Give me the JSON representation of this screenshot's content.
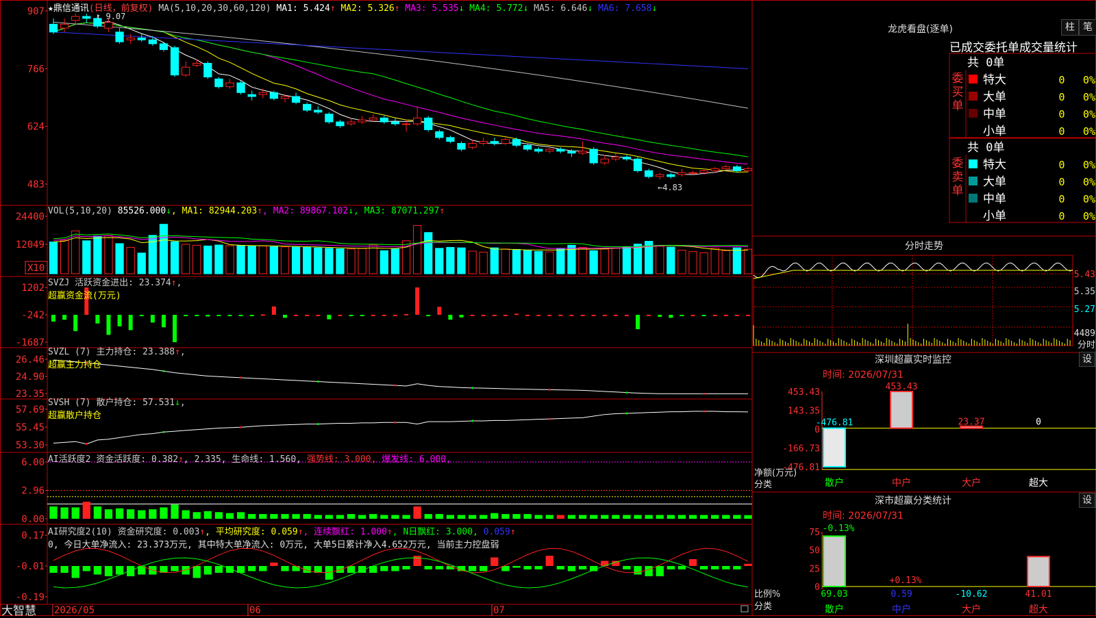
{
  "colors": {
    "up": "#ff2020",
    "down": "#00ffff",
    "ma1": "#ffffff",
    "ma2": "#ffff00",
    "ma3": "#ff00ff",
    "ma4": "#00ff00",
    "ma5": "#c0c0c0",
    "ma6": "#3333ff",
    "frame": "#c00000",
    "green": "#00ff00"
  },
  "header": {
    "star": "★",
    "name": "鼎信通讯",
    "mode": "(日线，前复权)",
    "ma_label": "MA(5,10,20,30,60,120)",
    "ma": [
      {
        "label": "MA1:",
        "value": "5.424",
        "arrow": "↑"
      },
      {
        "label": "MA2:",
        "value": "5.326",
        "arrow": "↑"
      },
      {
        "label": "MA3:",
        "value": "5.535",
        "arrow": "↓"
      },
      {
        "label": "MA4:",
        "value": "5.772",
        "arrow": "↓"
      },
      {
        "label": "MA5:",
        "value": "6.646",
        "arrow": "↓"
      },
      {
        "label": "MA6:",
        "value": "7.658",
        "arrow": "↓"
      }
    ],
    "high_mark": "9.07",
    "low_mark": "4.83"
  },
  "axes": {
    "price": [
      "907",
      "766",
      "624",
      "483"
    ],
    "vol": [
      "24400",
      "12049"
    ],
    "vol_unit": "X10",
    "svzj": [
      "1202",
      "-242",
      "-1687"
    ],
    "svzl": [
      "26.46",
      "24.90",
      "23.35"
    ],
    "svsh": [
      "57.69",
      "55.45",
      "53.30"
    ],
    "ai": [
      "6.00",
      "2.96",
      "0.00"
    ],
    "ai2": [
      "0.17",
      "-0.01",
      "-0.19"
    ]
  },
  "vol_header": {
    "label": "VOL(5,10,20)",
    "value": "85526.000",
    "arrow": "↓",
    "ma": [
      {
        "label": "MA1:",
        "value": "82944.203",
        "arrow": "↑"
      },
      {
        "label": "MA2:",
        "value": "89867.102",
        "arrow": "↓"
      },
      {
        "label": "MA3:",
        "value": "87071.297",
        "arrow": "↑"
      }
    ]
  },
  "svzj_header": {
    "label": "SVZJ  活跃资金进出: 23.374",
    "arrow": "↑",
    "sub": "超赢资金流(万元)"
  },
  "svzl_header": {
    "label": "SVZL (7) 主力持仓: 23.388",
    "arrow": "↑",
    "sub": "超赢主力持仓"
  },
  "svsh_header": {
    "label": "SVSH (7) 散户持仓: 57.531",
    "arrow": "↓",
    "sub": "超赢散户持仓"
  },
  "ai_header": {
    "a": "AI活跃度2 资金活跃度: 0.382",
    "a_arrow": "↑",
    "b": ", 2.335, 生命线: 1.560,",
    "c": "强势线: 3.000,",
    "d": "爆发线: 6.000,"
  },
  "ai2_header": {
    "a": "AI研究度2(10) 资金研究度: 0.003",
    "a_arrow": "↑",
    "b": ", 平均研究度: 0.059",
    "b_arrow": "↑",
    "c": ", 连续飘红: 1.000",
    "c_arrow": "↑",
    "d": ", N日飘红: 3.000,",
    "e": "0.059",
    "e_arrow": "↑"
  },
  "ai2_note": "0, 今日大单净流入: 23.373万元, 其中特大单净流入: 0万元, 大单5日累计净入4.652万元, 当前主力控盘弱",
  "bottom": {
    "brand": "大智慧",
    "dates": [
      "2026/05",
      "06",
      "07"
    ]
  },
  "dragon": {
    "title": "龙虎看盘(逐单)",
    "btn_a": "柱",
    "btn_b": "笔",
    "subtitle": "已成交委托单成交量统计",
    "buy": {
      "side": "委买单",
      "total": "共 0单",
      "rows": [
        {
          "name": "特大",
          "value": "0",
          "pct": "0%",
          "color": "#ff0000"
        },
        {
          "name": "大单",
          "value": "0",
          "pct": "0%",
          "color": "#990000"
        },
        {
          "name": "中单",
          "value": "0",
          "pct": "0%",
          "color": "#660000"
        },
        {
          "name": "小单",
          "value": "0",
          "pct": "0%",
          "color": "#000000"
        }
      ]
    },
    "sell": {
      "side": "委卖单",
      "total": "共 0单",
      "rows": [
        {
          "name": "特大",
          "value": "0",
          "pct": "0%",
          "color": "#00ffff"
        },
        {
          "name": "大单",
          "value": "0",
          "pct": "0%",
          "color": "#009999"
        },
        {
          "name": "中单",
          "value": "0",
          "pct": "0%",
          "color": "#007777"
        },
        {
          "name": "小单",
          "value": "0",
          "pct": "0%",
          "color": "#000000"
        }
      ]
    }
  },
  "intraday": {
    "title": "分时走势",
    "prices": [
      "5.43",
      "5.35",
      "5.27"
    ],
    "vol": "4489",
    "vol_label": "分时"
  },
  "monitor": {
    "title": "深圳超赢实时监控",
    "btn": "设",
    "time": "时间: 2026/07/31",
    "axis": [
      "453.43",
      "143.35",
      "0",
      "-166.73",
      "-476.81"
    ],
    "ylabel": "净额(万元)",
    "xlabel": "分类",
    "cats": [
      "散户",
      "中户",
      "大户",
      "超大"
    ],
    "values": [
      "-476.81",
      "453.43",
      "23.37",
      "0"
    ]
  },
  "stats": {
    "title": "深市超赢分类统计",
    "btn": "设",
    "time": "时间: 2026/07/31",
    "axis": [
      "75",
      "50",
      "25",
      "0"
    ],
    "ylabel": "比例%",
    "xlabel": "分类",
    "cats": [
      "散户",
      "中户",
      "大户",
      "超大"
    ],
    "values": [
      "69.03",
      "0.59",
      "-10.62",
      "41.01"
    ],
    "top_label": "-0.13%",
    "mid_label": "+0.13%"
  },
  "chart_data": [
    {
      "type": "candlestick",
      "title": "鼎信通讯",
      "ylim": [
        4.83,
        9.07
      ],
      "candles": [
        [
          8.8,
          8.6,
          8.95,
          8.55
        ],
        [
          8.7,
          8.8,
          8.95,
          8.6
        ],
        [
          8.9,
          9.0,
          9.07,
          8.8
        ],
        [
          9.0,
          8.95,
          9.07,
          8.85
        ],
        [
          8.95,
          8.75,
          9.05,
          8.7
        ],
        [
          8.7,
          8.85,
          8.95,
          8.6
        ],
        [
          8.6,
          8.35,
          8.7,
          8.3
        ],
        [
          8.4,
          8.45,
          8.55,
          8.3
        ],
        [
          8.45,
          8.4,
          8.55,
          8.35
        ],
        [
          8.4,
          8.3,
          8.5,
          8.25
        ],
        [
          8.3,
          8.15,
          8.35,
          8.1
        ],
        [
          8.2,
          7.5,
          8.25,
          7.45
        ],
        [
          7.5,
          7.7,
          7.85,
          7.45
        ],
        [
          7.75,
          7.8,
          7.9,
          7.7
        ],
        [
          7.8,
          7.45,
          7.85,
          7.4
        ],
        [
          7.4,
          7.2,
          7.45,
          7.15
        ],
        [
          7.2,
          7.3,
          7.4,
          7.15
        ],
        [
          7.3,
          7.05,
          7.35,
          7.0
        ],
        [
          7.0,
          6.95,
          7.1,
          6.85
        ],
        [
          7.0,
          7.05,
          7.15,
          6.9
        ],
        [
          7.05,
          6.9,
          7.1,
          6.85
        ],
        [
          6.9,
          6.95,
          7.0,
          6.8
        ],
        [
          6.95,
          6.8,
          7.05,
          6.75
        ],
        [
          6.75,
          6.6,
          6.8,
          6.55
        ],
        [
          6.6,
          6.55,
          6.7,
          6.5
        ],
        [
          6.5,
          6.3,
          6.55,
          6.25
        ],
        [
          6.3,
          6.2,
          6.35,
          6.15
        ],
        [
          6.25,
          6.3,
          6.4,
          6.2
        ],
        [
          6.3,
          6.35,
          6.45,
          6.25
        ],
        [
          6.35,
          6.4,
          6.5,
          6.3
        ],
        [
          6.4,
          6.3,
          6.45,
          6.25
        ],
        [
          6.3,
          6.25,
          6.4,
          6.2
        ],
        [
          6.25,
          6.25,
          6.35,
          6.05
        ],
        [
          6.25,
          6.4,
          6.7,
          6.2
        ],
        [
          6.4,
          6.1,
          6.45,
          6.05
        ],
        [
          6.05,
          5.9,
          6.1,
          5.85
        ],
        [
          5.9,
          5.8,
          5.95,
          5.75
        ],
        [
          5.75,
          5.6,
          5.8,
          5.55
        ],
        [
          5.65,
          5.75,
          5.85,
          5.6
        ],
        [
          5.75,
          5.8,
          5.9,
          5.7
        ],
        [
          5.8,
          5.75,
          5.9,
          5.7
        ],
        [
          5.75,
          5.85,
          5.95,
          5.7
        ],
        [
          5.85,
          5.7,
          5.9,
          5.65
        ],
        [
          5.7,
          5.6,
          5.75,
          5.55
        ],
        [
          5.6,
          5.55,
          5.65,
          5.5
        ],
        [
          5.55,
          5.6,
          5.7,
          5.5
        ],
        [
          5.6,
          5.55,
          5.65,
          5.5
        ],
        [
          5.55,
          5.5,
          5.6,
          5.4
        ],
        [
          5.5,
          5.55,
          5.8,
          5.45
        ],
        [
          5.6,
          5.25,
          5.65,
          5.2
        ],
        [
          5.25,
          5.35,
          5.45,
          5.2
        ],
        [
          5.35,
          5.4,
          5.5,
          5.3
        ],
        [
          5.4,
          5.35,
          5.45,
          5.3
        ],
        [
          5.35,
          5.05,
          5.4,
          5.0
        ],
        [
          5.05,
          4.9,
          5.1,
          4.85
        ],
        [
          4.9,
          4.95,
          5.0,
          4.83
        ],
        [
          4.95,
          4.9,
          5.0,
          4.85
        ],
        [
          4.95,
          5.0,
          5.1,
          4.9
        ],
        [
          5.0,
          5.0,
          5.05,
          4.95
        ],
        [
          5.0,
          5.05,
          5.1,
          4.95
        ],
        [
          5.05,
          5.1,
          5.15,
          5.0
        ],
        [
          5.1,
          5.15,
          5.2,
          5.05
        ],
        [
          5.15,
          5.05,
          5.2,
          5.0
        ],
        [
          5.05,
          5.1,
          5.15,
          5.0
        ]
      ]
    },
    {
      "type": "bar",
      "title": "VOL(5,10,20)",
      "values": [
        13500,
        14200,
        18200,
        14000,
        16000,
        16200,
        12800,
        11200,
        8800,
        16300,
        21000,
        13600,
        12500,
        12100,
        11800,
        12200,
        11900,
        12000,
        11700,
        11800,
        11500,
        11400,
        11300,
        11200,
        11000,
        10800,
        10600,
        10500,
        10700,
        12300,
        9800,
        10500,
        14000,
        20500,
        17500,
        10800,
        11200,
        11000,
        9600,
        9200,
        11000,
        10500,
        10300,
        10000,
        9500,
        9300,
        10800,
        12100,
        11200,
        9800,
        10500,
        10800,
        11500,
        12600,
        13800,
        11700,
        11300,
        10000,
        9400,
        8900,
        10800,
        9800,
        11000,
        10400
      ]
    },
    {
      "type": "bar",
      "title": "SVZJ",
      "values": [
        -600,
        -500,
        -1100,
        1202,
        -700,
        -1300,
        -850,
        -1050,
        -280,
        -650,
        -900,
        -1687,
        -300,
        -300,
        -330,
        -250,
        -300,
        -280,
        -250,
        -220,
        200,
        -400,
        -240,
        -240,
        -240,
        -480,
        -240,
        -300,
        -260,
        -240,
        -240,
        -240,
        -200,
        1202,
        -300,
        180,
        -500,
        -380,
        -240,
        -240,
        -240,
        -240,
        -180,
        -240,
        -240,
        -240,
        -240,
        -240,
        -240,
        -240,
        -240,
        -240,
        -240,
        -1000,
        -240,
        -350,
        -400,
        -300,
        -240,
        -250,
        -240,
        -240,
        -240,
        -240
      ]
    },
    {
      "type": "line",
      "title": "SVZL",
      "ylim": [
        23.35,
        26.46
      ],
      "values": [
        26.46,
        26.4,
        26.3,
        26.2,
        26.1,
        26.0,
        25.9,
        25.8,
        25.7,
        25.6,
        25.45,
        25.3,
        25.2,
        25.1,
        25.0,
        24.95,
        24.9,
        24.85,
        24.8,
        24.75,
        24.7,
        24.65,
        24.6,
        24.55,
        24.5,
        24.45,
        24.4,
        24.35,
        24.3,
        24.25,
        24.2,
        24.15,
        24.1,
        24.3,
        24.15,
        24.05,
        24.0,
        23.95,
        23.92,
        23.9,
        23.88,
        23.85,
        23.82,
        23.8,
        23.78,
        23.76,
        23.74,
        23.72,
        23.7,
        23.65,
        23.6,
        23.55,
        23.5,
        23.45,
        23.42,
        23.4,
        23.4,
        23.39,
        23.39,
        23.39,
        23.388,
        23.388,
        23.388,
        23.388
      ]
    },
    {
      "type": "line",
      "title": "SVSH",
      "ylim": [
        53.3,
        57.69
      ],
      "values": [
        53.6,
        53.7,
        53.8,
        53.5,
        54.0,
        54.1,
        54.3,
        54.5,
        54.7,
        54.8,
        55.0,
        55.1,
        55.2,
        55.3,
        55.4,
        55.5,
        55.55,
        55.6,
        55.7,
        55.8,
        55.85,
        55.9,
        55.95,
        56.0,
        56.0,
        56.05,
        56.1,
        56.1,
        56.15,
        56.15,
        56.2,
        56.2,
        56.2,
        56.0,
        56.3,
        56.3,
        56.3,
        56.35,
        56.4,
        56.4,
        56.45,
        56.45,
        56.5,
        56.55,
        56.6,
        56.65,
        56.7,
        56.75,
        56.8,
        57.0,
        57.2,
        57.3,
        57.35,
        57.4,
        57.45,
        57.5,
        57.55,
        57.55,
        57.6,
        57.6,
        57.6,
        57.55,
        57.55,
        57.531
      ]
    },
    {
      "type": "bar",
      "title": "AI活跃度2",
      "ylim": [
        0,
        6
      ],
      "values": [
        1.3,
        1.2,
        1.2,
        1.8,
        1.3,
        1.0,
        1.1,
        1.0,
        0.9,
        1.0,
        1.2,
        1.5,
        0.9,
        0.7,
        0.8,
        0.7,
        0.6,
        0.7,
        0.5,
        0.5,
        0.5,
        0.5,
        0.5,
        0.5,
        0.4,
        0.4,
        0.4,
        0.5,
        0.4,
        0.5,
        0.4,
        0.4,
        0.4,
        1.3,
        0.5,
        0.5,
        0.4,
        0.4,
        0.4,
        0.4,
        0.6,
        0.5,
        0.5,
        0.5,
        0.4,
        0.4,
        0.4,
        0.4,
        0.4,
        0.4,
        0.4,
        0.4,
        0.4,
        0.4,
        0.4,
        0.4,
        0.4,
        0.4,
        0.4,
        0.4,
        0.4,
        0.4,
        0.4,
        0.382
      ]
    },
    {
      "type": "bar",
      "title": "AI研究度2(10)",
      "ylim": [
        -0.19,
        0.17
      ],
      "values": [
        -0.05,
        -0.05,
        -0.08,
        -0.04,
        -0.06,
        -0.07,
        -0.06,
        -0.07,
        -0.06,
        -0.06,
        -0.05,
        -0.04,
        -0.06,
        -0.08,
        -0.06,
        -0.05,
        -0.05,
        -0.05,
        -0.04,
        -0.04,
        0.01,
        -0.04,
        -0.04,
        -0.05,
        -0.05,
        -0.09,
        -0.05,
        -0.05,
        -0.05,
        -0.05,
        -0.04,
        -0.04,
        -0.03,
        0.05,
        -0.03,
        -0.03,
        -0.03,
        -0.04,
        -0.04,
        -0.04,
        0.04,
        -0.04,
        -0.02,
        -0.03,
        -0.03,
        0.05,
        -0.03,
        -0.04,
        -0.03,
        -0.04,
        0.02,
        0.02,
        -0.03,
        -0.06,
        -0.07,
        -0.07,
        -0.03,
        -0.03,
        0.03,
        -0.03,
        -0.03,
        -0.03,
        -0.03,
        0.003
      ]
    }
  ]
}
